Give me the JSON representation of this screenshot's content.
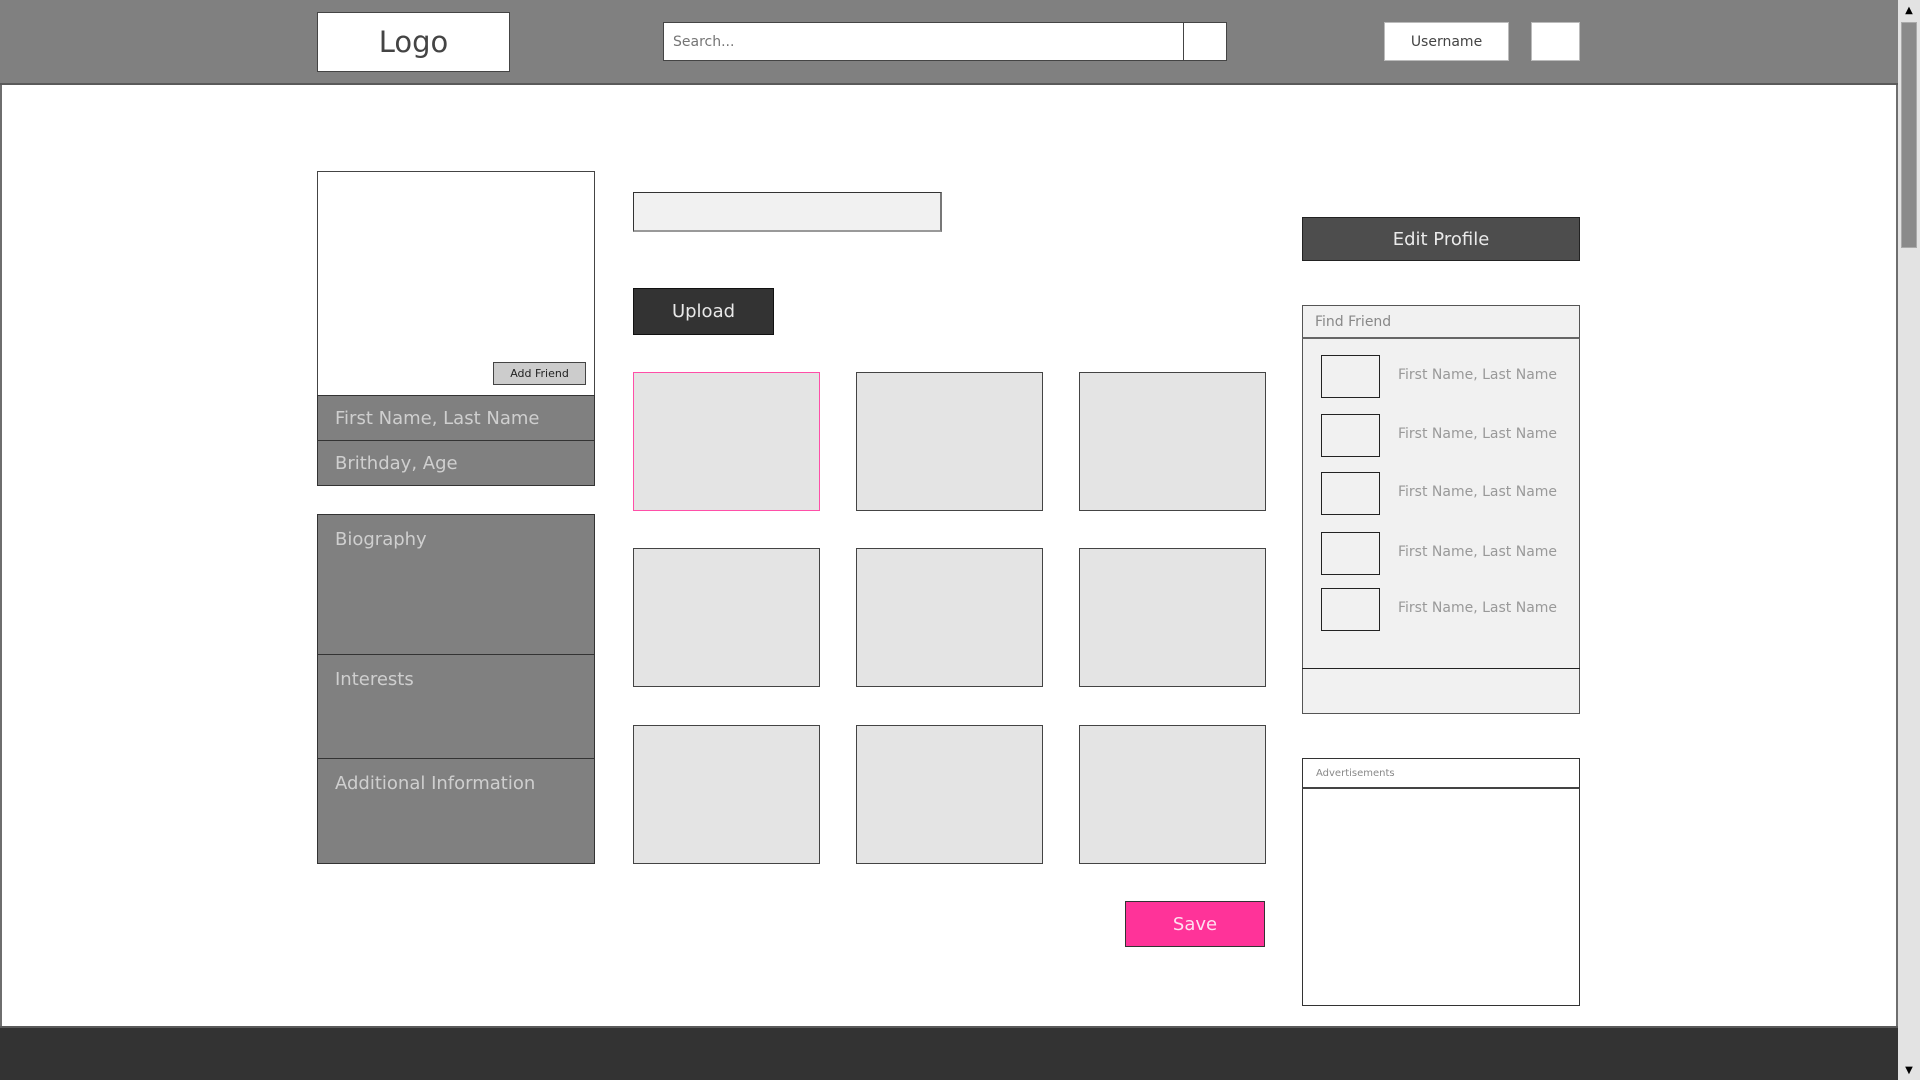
{
  "header": {
    "logo": "Logo",
    "search_placeholder": "Search...",
    "search_value": "",
    "username": "Username"
  },
  "profile": {
    "add_friend_label": "Add Friend",
    "name": "First Name, Last Name",
    "birthday": "Brithday, Age",
    "sections": {
      "biography": "Biography",
      "interests": "Interests",
      "additional": "Additional Information"
    }
  },
  "center": {
    "file_field_value": "",
    "upload_label": "Upload",
    "photo_count": 9,
    "selected_photo_index": 0,
    "save_label": "Save"
  },
  "sidebar": {
    "edit_profile_label": "Edit Profile",
    "find_friend": {
      "title": "Find Friend",
      "friends": [
        {
          "name": "First Name, Last Name"
        },
        {
          "name": "First Name, Last Name"
        },
        {
          "name": "First Name, Last Name"
        },
        {
          "name": "First Name, Last Name"
        },
        {
          "name": "First Name, Last Name"
        }
      ]
    },
    "ads_title": "Advertisements"
  },
  "colors": {
    "header_bg": "#808080",
    "footer_bg": "#333333",
    "accent_pink": "#ff3399",
    "dark_button": "#333333",
    "edit_button": "#4d4d4d"
  }
}
